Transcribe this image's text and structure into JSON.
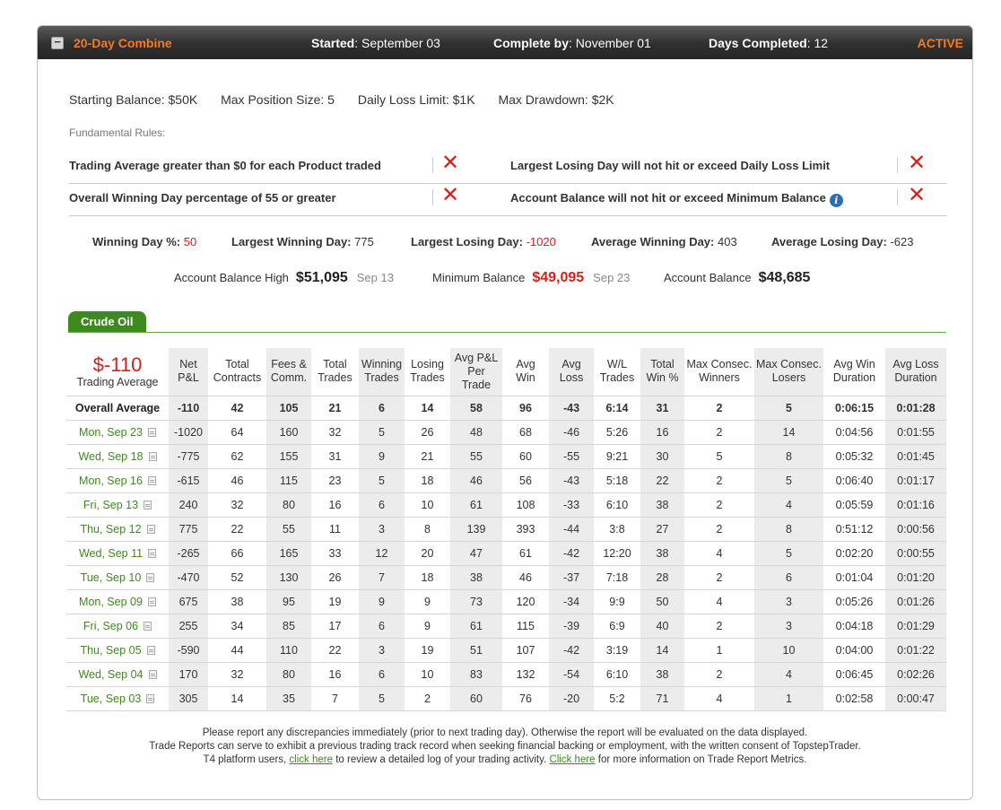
{
  "header": {
    "title": "20-Day Combine",
    "started_label": "Started",
    "started_value": "September 03",
    "complete_label": "Complete by",
    "complete_value": "November 01",
    "days_label": "Days Completed",
    "days_value": "12",
    "status": "ACTIVE",
    "collapse_symbol": "−"
  },
  "params": {
    "starting_balance": "Starting Balance: $50K",
    "max_position": "Max Position Size: 5",
    "daily_loss": "Daily Loss Limit: $1K",
    "max_drawdown": "Max Drawdown: $2K"
  },
  "fundamental_label": "Fundamental Rules:",
  "rules": [
    {
      "left": "Trading Average greater than $0 for each Product traded",
      "right": "Largest Losing Day will not hit or exceed Daily Loss Limit"
    },
    {
      "left": "Overall Winning Day percentage of 55 or greater",
      "right": "Account Balance will not hit or exceed Minimum Balance"
    }
  ],
  "fail_mark": "✕",
  "info_symbol": "i",
  "stats": {
    "winning_day_label": "Winning Day %:",
    "winning_day_value": "50",
    "largest_win_label": "Largest Winning Day:",
    "largest_win_value": "775",
    "largest_loss_label": "Largest Losing Day:",
    "largest_loss_value": "-1020",
    "avg_win_label": "Average Winning Day:",
    "avg_win_value": "403",
    "avg_loss_label": "Average Losing Day:",
    "avg_loss_value": "-623"
  },
  "balances": {
    "high_label": "Account Balance High",
    "high_value": "$51,095",
    "high_date": "Sep 13",
    "min_label": "Minimum Balance",
    "min_value": "$49,095",
    "min_date": "Sep 23",
    "bal_label": "Account Balance",
    "bal_value": "$48,685"
  },
  "product_tab": "Crude Oil",
  "trading_average_value": "$-110",
  "trading_average_label": "Trading Average",
  "columns": [
    [
      "Net",
      "P&L"
    ],
    [
      "Total",
      "Contracts"
    ],
    [
      "Fees &",
      "Comm."
    ],
    [
      "Total",
      "Trades"
    ],
    [
      "Winning",
      "Trades"
    ],
    [
      "Losing",
      "Trades"
    ],
    [
      "Avg P&L",
      "Per Trade"
    ],
    [
      "Avg",
      "Win"
    ],
    [
      "Avg",
      "Loss"
    ],
    [
      "W/L",
      "Trades"
    ],
    [
      "Total",
      "Win %"
    ],
    [
      "Max Consec.",
      "Winners"
    ],
    [
      "Max Consec.",
      "Losers"
    ],
    [
      "Avg Win",
      "Duration"
    ],
    [
      "Avg Loss",
      "Duration"
    ]
  ],
  "overall": [
    "Overall Average",
    "-110",
    "42",
    "105",
    "21",
    "6",
    "14",
    "58",
    "96",
    "-43",
    "6:14",
    "31",
    "2",
    "5",
    "0:06:15",
    "0:01:28"
  ],
  "rows": [
    [
      "Mon, Sep 23",
      "-1020",
      "64",
      "160",
      "32",
      "5",
      "26",
      "48",
      "68",
      "-46",
      "5:26",
      "16",
      "2",
      "14",
      "0:04:56",
      "0:01:55"
    ],
    [
      "Wed, Sep 18",
      "-775",
      "62",
      "155",
      "31",
      "9",
      "21",
      "55",
      "60",
      "-55",
      "9:21",
      "30",
      "5",
      "8",
      "0:05:32",
      "0:01:45"
    ],
    [
      "Mon, Sep 16",
      "-615",
      "46",
      "115",
      "23",
      "5",
      "18",
      "46",
      "56",
      "-43",
      "5:18",
      "22",
      "2",
      "5",
      "0:06:40",
      "0:01:17"
    ],
    [
      "Fri, Sep 13",
      "240",
      "32",
      "80",
      "16",
      "6",
      "10",
      "61",
      "108",
      "-33",
      "6:10",
      "38",
      "2",
      "4",
      "0:05:59",
      "0:01:16"
    ],
    [
      "Thu, Sep 12",
      "775",
      "22",
      "55",
      "11",
      "3",
      "8",
      "139",
      "393",
      "-44",
      "3:8",
      "27",
      "2",
      "8",
      "0:51:12",
      "0:00:56"
    ],
    [
      "Wed, Sep 11",
      "-265",
      "66",
      "165",
      "33",
      "12",
      "20",
      "47",
      "61",
      "-42",
      "12:20",
      "38",
      "4",
      "5",
      "0:02:20",
      "0:00:55"
    ],
    [
      "Tue, Sep 10",
      "-470",
      "52",
      "130",
      "26",
      "7",
      "18",
      "38",
      "46",
      "-37",
      "7:18",
      "28",
      "2",
      "6",
      "0:01:04",
      "0:01:20"
    ],
    [
      "Mon, Sep 09",
      "675",
      "38",
      "95",
      "19",
      "9",
      "9",
      "73",
      "120",
      "-34",
      "9:9",
      "50",
      "4",
      "3",
      "0:05:26",
      "0:01:26"
    ],
    [
      "Fri, Sep 06",
      "255",
      "34",
      "85",
      "17",
      "6",
      "9",
      "61",
      "115",
      "-39",
      "6:9",
      "40",
      "2",
      "3",
      "0:04:18",
      "0:01:29"
    ],
    [
      "Thu, Sep 05",
      "-590",
      "44",
      "110",
      "22",
      "3",
      "19",
      "51",
      "107",
      "-42",
      "3:19",
      "14",
      "1",
      "10",
      "0:04:00",
      "0:01:22"
    ],
    [
      "Wed, Sep 04",
      "170",
      "32",
      "80",
      "16",
      "6",
      "10",
      "83",
      "132",
      "-54",
      "6:10",
      "38",
      "2",
      "4",
      "0:06:45",
      "0:02:26"
    ],
    [
      "Tue, Sep 03",
      "305",
      "14",
      "35",
      "7",
      "5",
      "2",
      "60",
      "76",
      "-20",
      "5:2",
      "71",
      "4",
      "1",
      "0:02:58",
      "0:00:47"
    ]
  ],
  "footer": {
    "line1": "Please report any discrepancies immediately (prior to next trading day). Otherwise the report will be evaluated on the data displayed.",
    "line2": "Trade Reports can serve to exhibit a previous trading track record when seeking financial backing or employment, with the written consent of TopstepTrader.",
    "line3_pre": "T4 platform users,",
    "link1": "click here",
    "line3_mid": "to review a detailed log of your trading activity.",
    "link2": "Click here",
    "line3_post": "for more information on Trade Report Metrics."
  }
}
